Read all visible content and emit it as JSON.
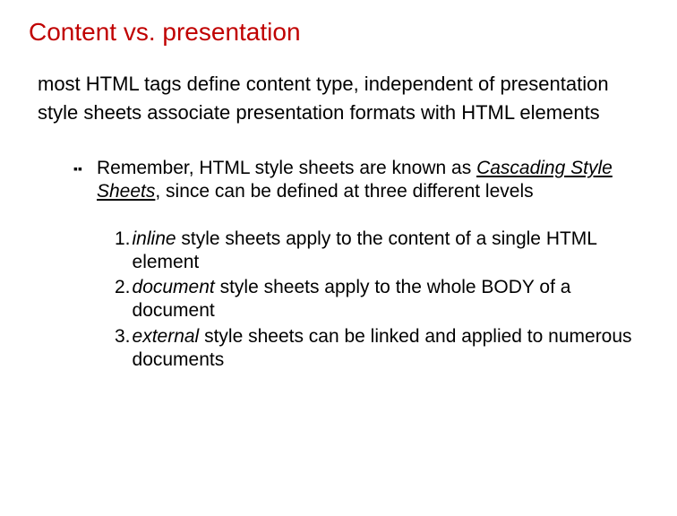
{
  "title": "Content vs. presentation",
  "para1": "most HTML tags define content type, independent of presentation",
  "para2": "style sheets associate presentation formats with HTML elements",
  "bullet": {
    "pre": "Remember, HTML style sheets are known as ",
    "em": "Cascading Style Sheets",
    "post": ", since can be defined at three different levels"
  },
  "items": [
    {
      "num": "1.",
      "em": "inline",
      "rest": " style sheets apply to the content of a single HTML element"
    },
    {
      "num": "2.",
      "em": "document",
      "rest": " style sheets apply to the whole BODY of a document"
    },
    {
      "num": "3.",
      "em": "external",
      "rest": " style sheets can be linked and applied to numerous documents"
    }
  ]
}
